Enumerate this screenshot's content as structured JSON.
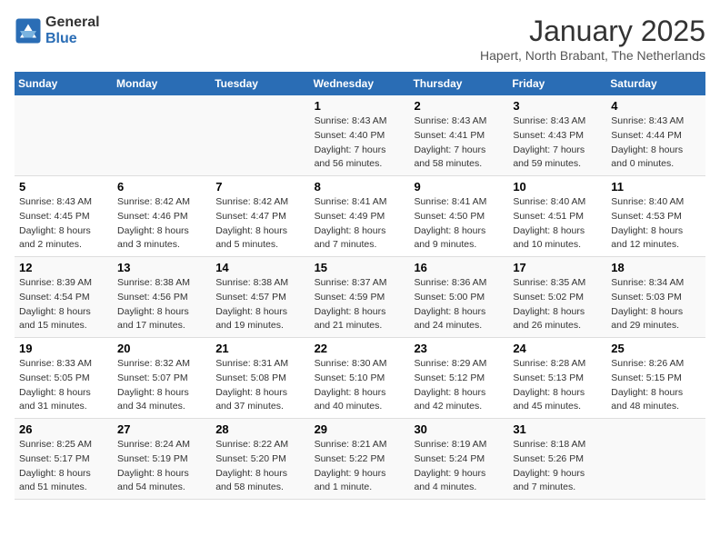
{
  "header": {
    "logo_general": "General",
    "logo_blue": "Blue",
    "month": "January 2025",
    "location": "Hapert, North Brabant, The Netherlands"
  },
  "weekdays": [
    "Sunday",
    "Monday",
    "Tuesday",
    "Wednesday",
    "Thursday",
    "Friday",
    "Saturday"
  ],
  "weeks": [
    [
      {
        "day": "",
        "info": ""
      },
      {
        "day": "",
        "info": ""
      },
      {
        "day": "",
        "info": ""
      },
      {
        "day": "1",
        "info": "Sunrise: 8:43 AM\nSunset: 4:40 PM\nDaylight: 7 hours\nand 56 minutes."
      },
      {
        "day": "2",
        "info": "Sunrise: 8:43 AM\nSunset: 4:41 PM\nDaylight: 7 hours\nand 58 minutes."
      },
      {
        "day": "3",
        "info": "Sunrise: 8:43 AM\nSunset: 4:43 PM\nDaylight: 7 hours\nand 59 minutes."
      },
      {
        "day": "4",
        "info": "Sunrise: 8:43 AM\nSunset: 4:44 PM\nDaylight: 8 hours\nand 0 minutes."
      }
    ],
    [
      {
        "day": "5",
        "info": "Sunrise: 8:43 AM\nSunset: 4:45 PM\nDaylight: 8 hours\nand 2 minutes."
      },
      {
        "day": "6",
        "info": "Sunrise: 8:42 AM\nSunset: 4:46 PM\nDaylight: 8 hours\nand 3 minutes."
      },
      {
        "day": "7",
        "info": "Sunrise: 8:42 AM\nSunset: 4:47 PM\nDaylight: 8 hours\nand 5 minutes."
      },
      {
        "day": "8",
        "info": "Sunrise: 8:41 AM\nSunset: 4:49 PM\nDaylight: 8 hours\nand 7 minutes."
      },
      {
        "day": "9",
        "info": "Sunrise: 8:41 AM\nSunset: 4:50 PM\nDaylight: 8 hours\nand 9 minutes."
      },
      {
        "day": "10",
        "info": "Sunrise: 8:40 AM\nSunset: 4:51 PM\nDaylight: 8 hours\nand 10 minutes."
      },
      {
        "day": "11",
        "info": "Sunrise: 8:40 AM\nSunset: 4:53 PM\nDaylight: 8 hours\nand 12 minutes."
      }
    ],
    [
      {
        "day": "12",
        "info": "Sunrise: 8:39 AM\nSunset: 4:54 PM\nDaylight: 8 hours\nand 15 minutes."
      },
      {
        "day": "13",
        "info": "Sunrise: 8:38 AM\nSunset: 4:56 PM\nDaylight: 8 hours\nand 17 minutes."
      },
      {
        "day": "14",
        "info": "Sunrise: 8:38 AM\nSunset: 4:57 PM\nDaylight: 8 hours\nand 19 minutes."
      },
      {
        "day": "15",
        "info": "Sunrise: 8:37 AM\nSunset: 4:59 PM\nDaylight: 8 hours\nand 21 minutes."
      },
      {
        "day": "16",
        "info": "Sunrise: 8:36 AM\nSunset: 5:00 PM\nDaylight: 8 hours\nand 24 minutes."
      },
      {
        "day": "17",
        "info": "Sunrise: 8:35 AM\nSunset: 5:02 PM\nDaylight: 8 hours\nand 26 minutes."
      },
      {
        "day": "18",
        "info": "Sunrise: 8:34 AM\nSunset: 5:03 PM\nDaylight: 8 hours\nand 29 minutes."
      }
    ],
    [
      {
        "day": "19",
        "info": "Sunrise: 8:33 AM\nSunset: 5:05 PM\nDaylight: 8 hours\nand 31 minutes."
      },
      {
        "day": "20",
        "info": "Sunrise: 8:32 AM\nSunset: 5:07 PM\nDaylight: 8 hours\nand 34 minutes."
      },
      {
        "day": "21",
        "info": "Sunrise: 8:31 AM\nSunset: 5:08 PM\nDaylight: 8 hours\nand 37 minutes."
      },
      {
        "day": "22",
        "info": "Sunrise: 8:30 AM\nSunset: 5:10 PM\nDaylight: 8 hours\nand 40 minutes."
      },
      {
        "day": "23",
        "info": "Sunrise: 8:29 AM\nSunset: 5:12 PM\nDaylight: 8 hours\nand 42 minutes."
      },
      {
        "day": "24",
        "info": "Sunrise: 8:28 AM\nSunset: 5:13 PM\nDaylight: 8 hours\nand 45 minutes."
      },
      {
        "day": "25",
        "info": "Sunrise: 8:26 AM\nSunset: 5:15 PM\nDaylight: 8 hours\nand 48 minutes."
      }
    ],
    [
      {
        "day": "26",
        "info": "Sunrise: 8:25 AM\nSunset: 5:17 PM\nDaylight: 8 hours\nand 51 minutes."
      },
      {
        "day": "27",
        "info": "Sunrise: 8:24 AM\nSunset: 5:19 PM\nDaylight: 8 hours\nand 54 minutes."
      },
      {
        "day": "28",
        "info": "Sunrise: 8:22 AM\nSunset: 5:20 PM\nDaylight: 8 hours\nand 58 minutes."
      },
      {
        "day": "29",
        "info": "Sunrise: 8:21 AM\nSunset: 5:22 PM\nDaylight: 9 hours\nand 1 minute."
      },
      {
        "day": "30",
        "info": "Sunrise: 8:19 AM\nSunset: 5:24 PM\nDaylight: 9 hours\nand 4 minutes."
      },
      {
        "day": "31",
        "info": "Sunrise: 8:18 AM\nSunset: 5:26 PM\nDaylight: 9 hours\nand 7 minutes."
      },
      {
        "day": "",
        "info": ""
      }
    ]
  ]
}
